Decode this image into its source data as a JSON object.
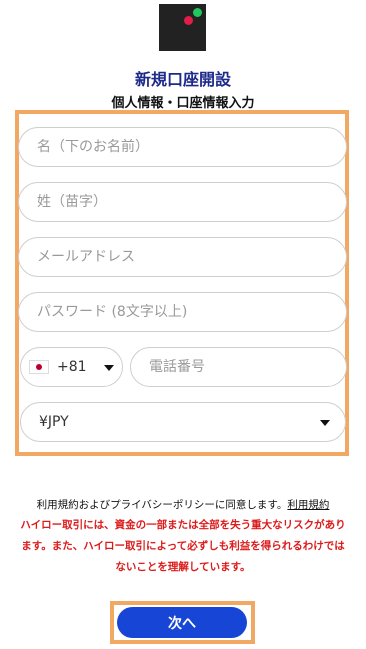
{
  "header": {
    "title": "新規口座開設",
    "subtitle": "個人情報・口座情報入力"
  },
  "form": {
    "first_name_placeholder": "名（下のお名前）",
    "last_name_placeholder": "姓（苗字）",
    "email_placeholder": "メールアドレス",
    "password_placeholder": "パスワード (8文字以上)",
    "phone_placeholder": "電話番号",
    "country_code": "+81",
    "currency": "¥JPY"
  },
  "footer": {
    "terms_text": "利用規約およびプライバシーポリシーに同意します。",
    "terms_link": "利用規約",
    "risk_text": "ハイロー取引には、資金の一部または全部を失う重大なリスクがあります。また、ハイロー取引によって必ずしも利益を得られるわけではないことを理解しています。",
    "next_button": "次へ"
  },
  "colors": {
    "brand_blue": "#1746d6",
    "title_blue": "#1e2a8a",
    "warning_red": "#dc1b1b",
    "highlight_orange": "#f0a862"
  },
  "icons": {
    "logo": "app-logo-icon",
    "flag": "japan-flag-icon",
    "dropdown": "chevron-down-icon"
  }
}
